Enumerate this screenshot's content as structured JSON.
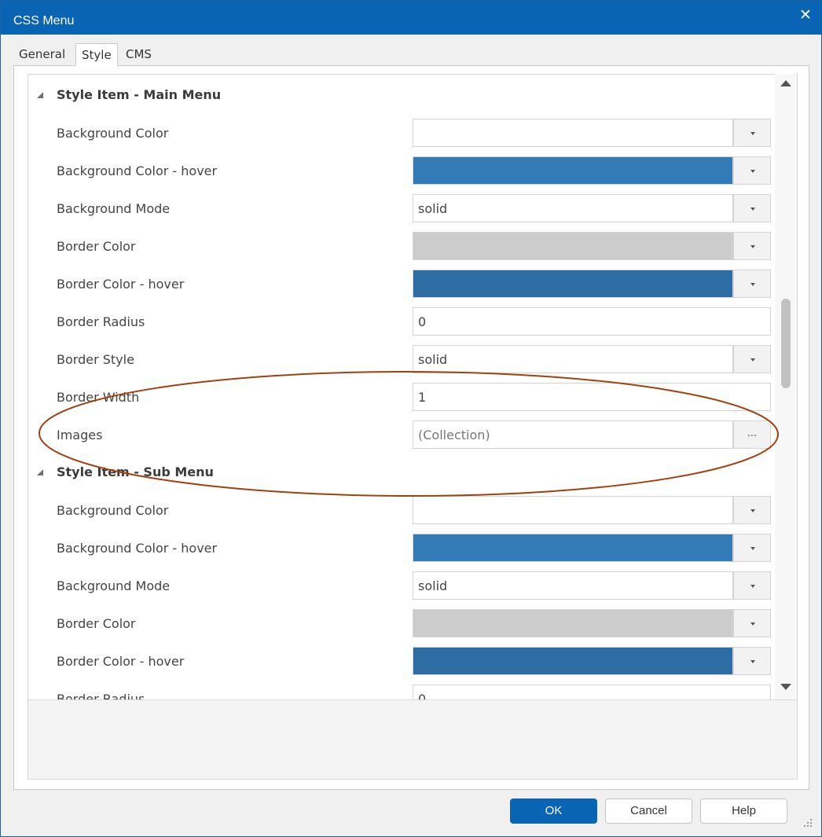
{
  "window": {
    "title": "CSS Menu",
    "close_glyph": "✕"
  },
  "tabs": [
    {
      "label": "General",
      "active": false
    },
    {
      "label": "Style",
      "active": true
    },
    {
      "label": "CMS",
      "active": false
    }
  ],
  "property_grid": {
    "main_menu": {
      "category": "Style Item - Main Menu",
      "rows": [
        {
          "label": "Background Color",
          "value": "",
          "swatch": "#ffffff",
          "button": "dropdown"
        },
        {
          "label": "Background Color - hover",
          "value": "",
          "swatch": "#337ab7",
          "button": "dropdown"
        },
        {
          "label": "Background Mode",
          "value": "solid",
          "swatch": null,
          "button": "dropdown"
        },
        {
          "label": "Border Color",
          "value": "",
          "swatch": "#cccccc",
          "button": "dropdown"
        },
        {
          "label": "Border Color - hover",
          "value": "",
          "swatch": "#2e6da4",
          "button": "dropdown"
        },
        {
          "label": "Border Radius",
          "value": "0",
          "swatch": null,
          "button": "none"
        },
        {
          "label": "Border Style",
          "value": "solid",
          "swatch": null,
          "button": "dropdown"
        },
        {
          "label": "Border Width",
          "value": "1",
          "swatch": null,
          "button": "none"
        },
        {
          "label": "Images",
          "value": "(Collection)",
          "swatch": null,
          "button": "ellipsis"
        }
      ]
    },
    "sub_menu": {
      "category": "Style Item - Sub Menu",
      "rows": [
        {
          "label": "Background Color",
          "value": "",
          "swatch": "#ffffff",
          "button": "dropdown"
        },
        {
          "label": "Background Color - hover",
          "value": "",
          "swatch": "#337ab7",
          "button": "dropdown"
        },
        {
          "label": "Background Mode",
          "value": "solid",
          "swatch": null,
          "button": "dropdown"
        },
        {
          "label": "Border Color",
          "value": "",
          "swatch": "#cccccc",
          "button": "dropdown"
        },
        {
          "label": "Border Color - hover",
          "value": "",
          "swatch": "#2e6da4",
          "button": "dropdown"
        },
        {
          "label": "Border Radius",
          "value": "0",
          "swatch": null,
          "button": "none"
        }
      ]
    }
  },
  "buttons": {
    "ok": "OK",
    "cancel": "Cancel",
    "help": "Help"
  },
  "ellipsis_glyph": "...",
  "colors": {
    "accent": "#0a64b4",
    "annotation": "#a0410f"
  },
  "icons": {
    "close": "close-icon",
    "collapse": "triangle-collapse-icon",
    "dropdown": "chevron-down-icon",
    "scroll_up": "scroll-up-arrow-icon",
    "scroll_down": "scroll-down-arrow-icon",
    "resize": "resize-grip-icon"
  }
}
